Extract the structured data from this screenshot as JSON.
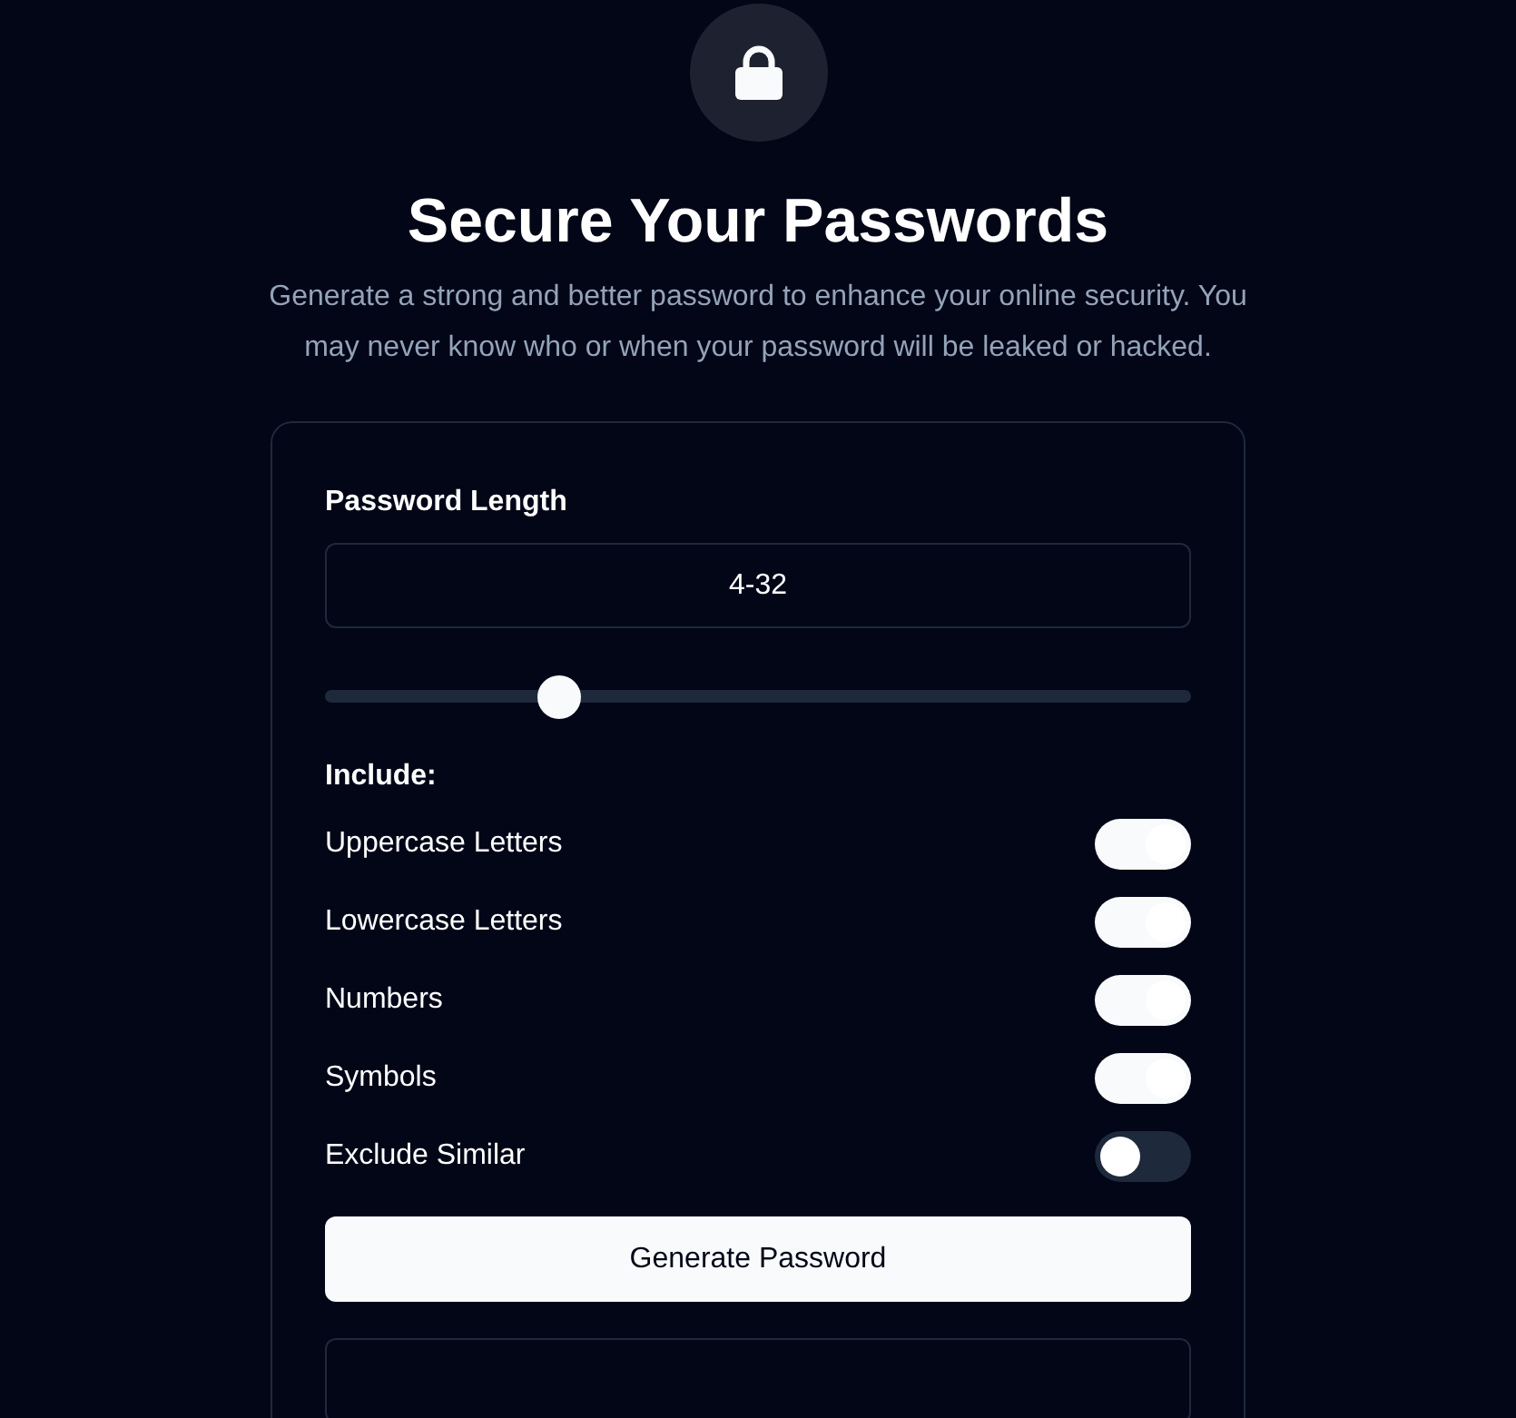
{
  "header": {
    "title": "Secure Your Passwords",
    "description": "Generate a strong and better password to enhance your online security. You may never know who or when your password will be leaked or hacked."
  },
  "length": {
    "label": "Password Length",
    "placeholder": "4-32",
    "level": 0.27
  },
  "include": {
    "label": "Include:",
    "options": [
      {
        "label": "Uppercase Letters",
        "on": true
      },
      {
        "label": "Lowercase Letters",
        "on": true
      },
      {
        "label": "Numbers",
        "on": true
      },
      {
        "label": "Symbols",
        "on": true
      },
      {
        "label": "Exclude Similar",
        "on": false
      }
    ]
  },
  "button": {
    "label": "Generate Password"
  }
}
